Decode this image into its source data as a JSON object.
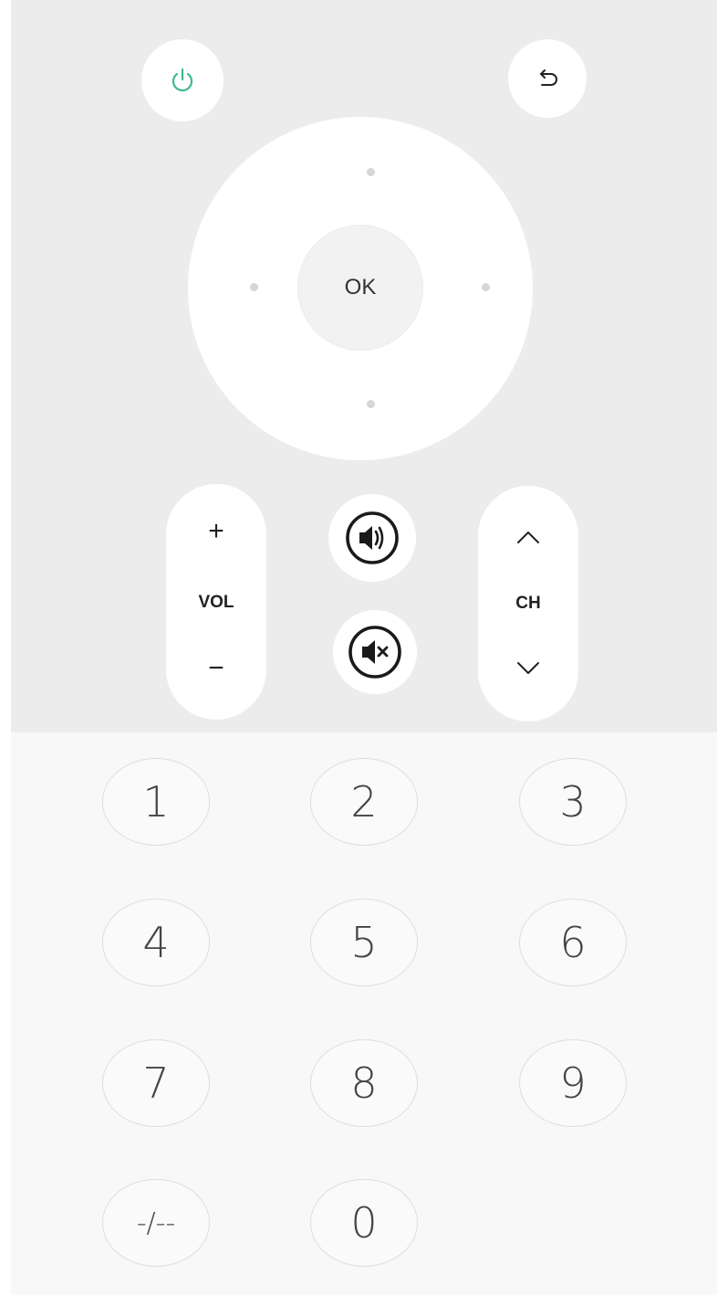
{
  "colors": {
    "top_background": "#ececec",
    "keypad_background": "#f8f8f8",
    "button_background": "#ffffff",
    "power_icon": "#3dba8a",
    "text": "#333333"
  },
  "top_controls": {
    "power_icon": "power-icon",
    "back_icon": "back-arrow-icon"
  },
  "dpad": {
    "ok_label": "OK"
  },
  "volume": {
    "plus_label": "+",
    "label": "VOL",
    "minus_label": "−"
  },
  "channel": {
    "up_icon": "chevron-up-icon",
    "label": "CH",
    "down_icon": "chevron-down-icon"
  },
  "audio": {
    "speaker_icon": "speaker-icon",
    "mute_icon": "mute-icon"
  },
  "keypad": {
    "keys": [
      "1",
      "2",
      "3",
      "4",
      "5",
      "6",
      "7",
      "8",
      "9",
      "-/--",
      "0"
    ]
  }
}
